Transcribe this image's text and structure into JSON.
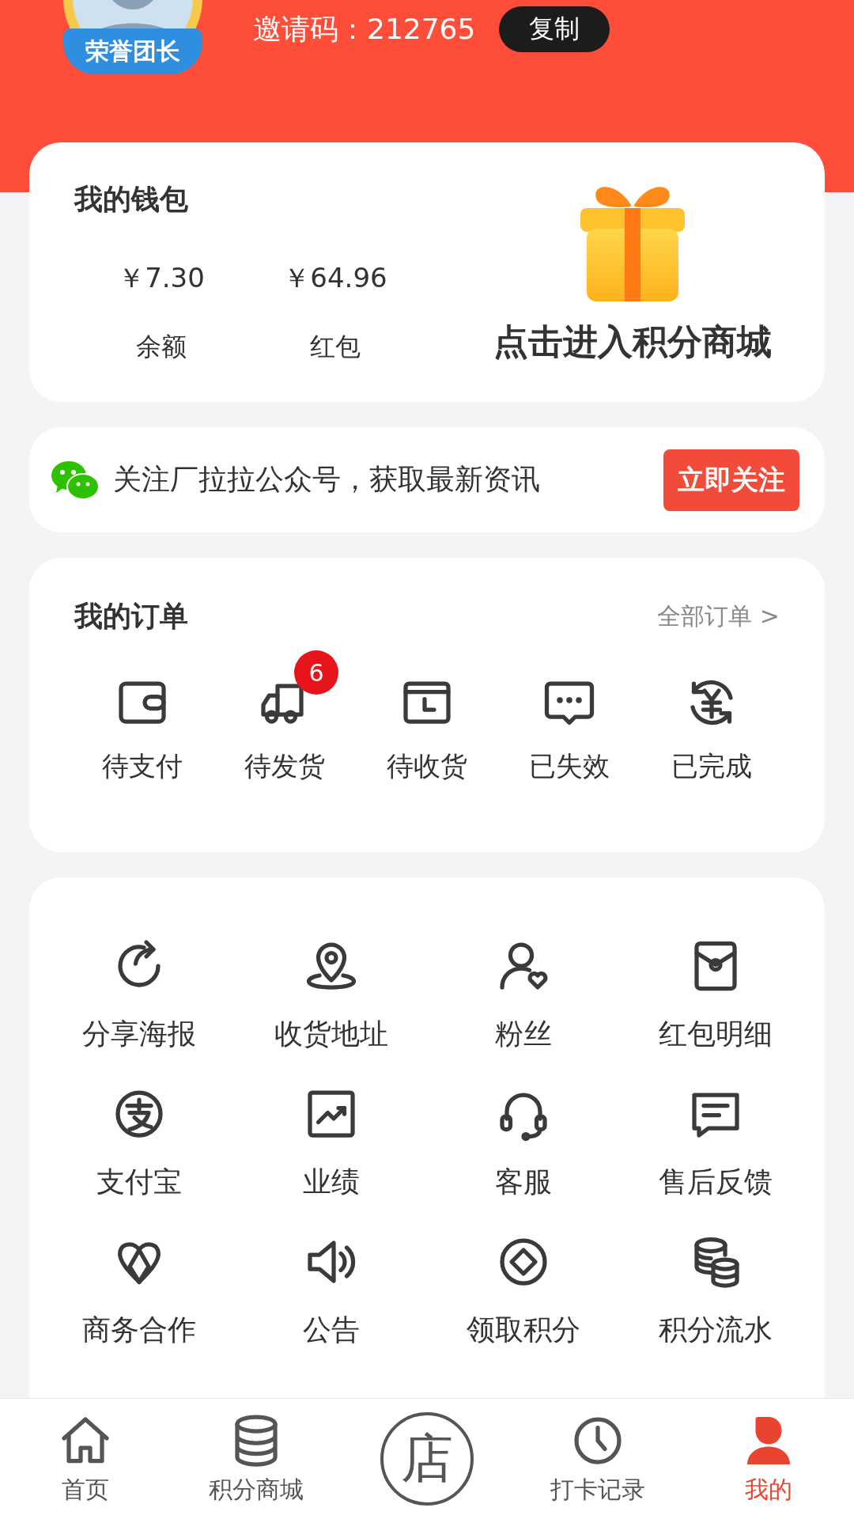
{
  "header": {
    "badge": "荣誉团长",
    "invite": "邀请码：212765",
    "copy_button": "复制"
  },
  "wallet": {
    "title": "我的钱包",
    "balances": [
      {
        "amount": "￥7.30",
        "label": "余额"
      },
      {
        "amount": "￥64.96",
        "label": "红包"
      }
    ],
    "mall_link": "点击进入积分商城"
  },
  "follow": {
    "text": "关注厂拉拉公众号，获取最新资讯",
    "button": "立即关注"
  },
  "orders": {
    "title": "我的订单",
    "view_all": "全部订单 >",
    "items": [
      {
        "kind": "wallet",
        "label": "待支付"
      },
      {
        "kind": "truck",
        "label": "待发货",
        "badge": "6"
      },
      {
        "kind": "box-clock",
        "label": "待收货"
      },
      {
        "kind": "chat-dots",
        "label": "已失效"
      },
      {
        "kind": "yen-cycle",
        "label": "已完成"
      }
    ]
  },
  "services": [
    {
      "kind": "share",
      "label": "分享海报"
    },
    {
      "kind": "location",
      "label": "收货地址"
    },
    {
      "kind": "fans",
      "label": "粉丝"
    },
    {
      "kind": "red-packet",
      "label": "红包明细"
    },
    {
      "kind": "alipay",
      "label": "支付宝"
    },
    {
      "kind": "chart",
      "label": "业绩"
    },
    {
      "kind": "headset",
      "label": "客服"
    },
    {
      "kind": "feedback",
      "label": "售后反馈"
    },
    {
      "kind": "cooperation",
      "label": "商务合作"
    },
    {
      "kind": "speaker",
      "label": "公告"
    },
    {
      "kind": "diamond-circle",
      "label": "领取积分"
    },
    {
      "kind": "coins",
      "label": "积分流水"
    }
  ],
  "nav": {
    "items": [
      {
        "kind": "home",
        "label": "首页",
        "selected": false
      },
      {
        "kind": "coins-stack",
        "label": "积分商城",
        "selected": false
      },
      {
        "kind": "store",
        "label": "店",
        "selected": false
      },
      {
        "kind": "clock",
        "label": "打卡记录",
        "selected": false
      },
      {
        "kind": "person",
        "label": "我的",
        "selected": true
      }
    ]
  }
}
